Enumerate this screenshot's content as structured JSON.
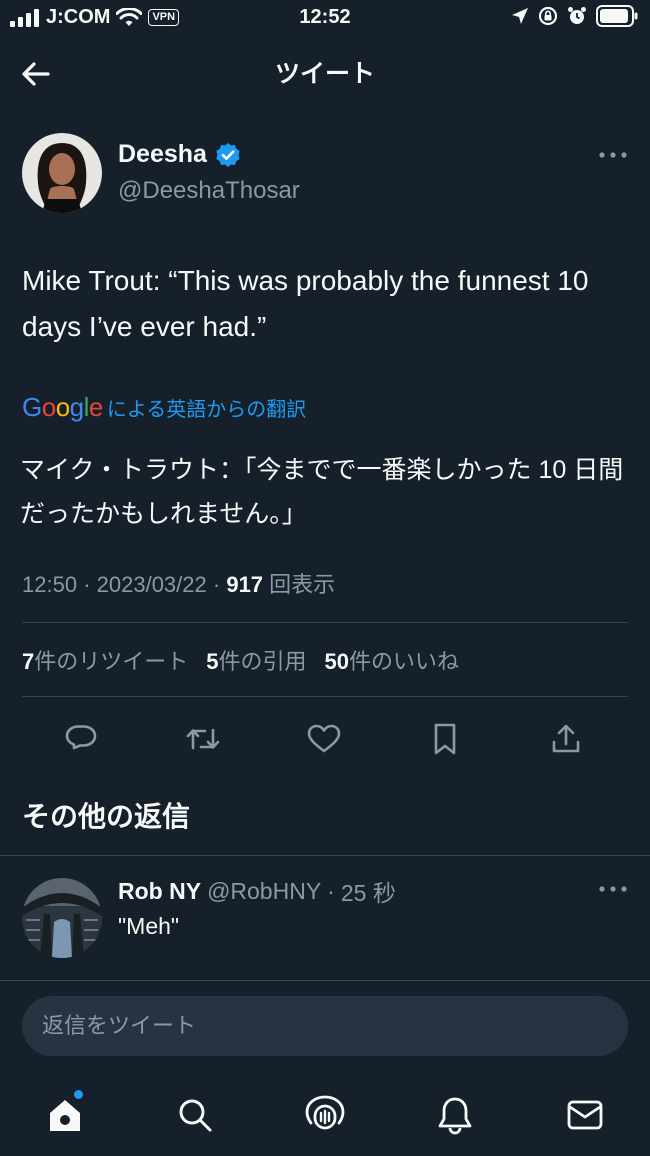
{
  "status_bar": {
    "carrier": "J:COM",
    "vpn": "VPN",
    "time": "12:52"
  },
  "header": {
    "title": "ツイート",
    "back_icon": "arrow-left-icon"
  },
  "tweet": {
    "author_name": "Deesha",
    "verified": true,
    "author_handle": "@DeeshaThosar",
    "text": "Mike Trout: “This was probably the funnest 10 days I’ve ever had.”",
    "translation_label": "による英語からの翻訳",
    "translation_brand": "Google",
    "translated_text": "マイク・トラウト：「今までで一番楽しかった 10 日間だったかもしれません。」",
    "time": "12:50",
    "date": "2023/03/22",
    "views_count": "917",
    "views_label": "回表示",
    "retweets_count": "7",
    "retweets_label": "件のリツイート",
    "quotes_count": "5",
    "quotes_label": "件の引用",
    "likes_count": "50",
    "likes_label": "件のいいね"
  },
  "actions": [
    "reply-icon",
    "retweet-icon",
    "like-icon",
    "bookmark-icon",
    "share-icon"
  ],
  "replies_section": {
    "title": "その他の返信"
  },
  "reply": {
    "name": "Rob NY",
    "handle": "@RobHNY",
    "time": "25 秒",
    "text": "\"Meh\""
  },
  "composer": {
    "placeholder": "返信をツイート"
  },
  "tab_bar": [
    "home-icon",
    "search-icon",
    "spaces-icon",
    "notifications-icon",
    "messages-icon"
  ],
  "colors": {
    "background": "#15202b",
    "accent": "#1d9bf0",
    "muted": "#8b98a5"
  }
}
